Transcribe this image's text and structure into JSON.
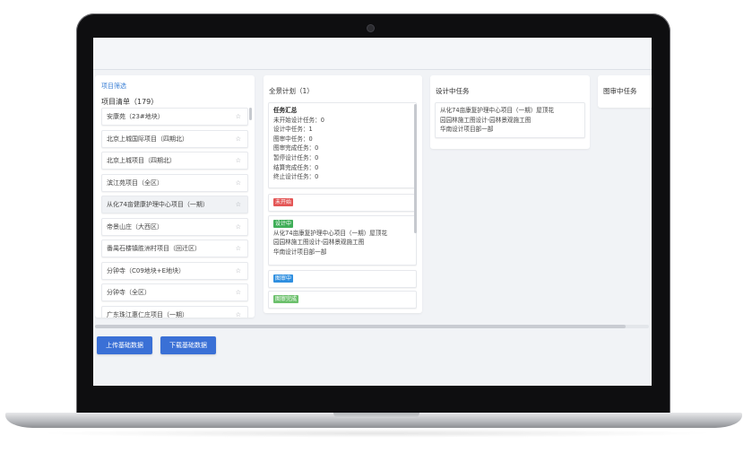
{
  "filter": {
    "title": "项目筛选",
    "list_label": "项目清单（179）"
  },
  "projects": [
    {
      "name": "安康苑（23#地块）",
      "active": false
    },
    {
      "name": "北京上城国际项目（四期北）",
      "active": false
    },
    {
      "name": "北京上城项目（四期北）",
      "active": false
    },
    {
      "name": "滨江苑项目（全区）",
      "active": false
    },
    {
      "name": "从化74亩健康护理中心项目（一期）",
      "active": true
    },
    {
      "name": "帝景山庄（大西区）",
      "active": false
    },
    {
      "name": "番禺石楼镇胜洲村项目（回迁区）",
      "active": false
    },
    {
      "name": "分钟寺（C09地块+E地块）",
      "active": false
    },
    {
      "name": "分钟寺（全区）",
      "active": false
    },
    {
      "name": "广东珠江惠仁庄项目（一期）",
      "active": false
    }
  ],
  "star_glyph": "☆",
  "columns": {
    "overview": {
      "title": "全景计划（1）",
      "summary": {
        "heading": "任务汇总",
        "lines": [
          "未开始设计任务：0",
          "设计中任务：1",
          "图审中任务：0",
          "图审完成任务：0",
          "暂停设计任务：0",
          "结算完成任务：0",
          "终止设计任务：0"
        ]
      },
      "statuses": [
        {
          "tag": "未开始",
          "color": "#e45656"
        },
        {
          "tag": "设计中",
          "color": "#3fae58",
          "lines": [
            "从化74亩康复护理中心项目（一期）屋顶花",
            "园园林施工图设计-园林景观施工图",
            "华南设计项目部一部"
          ]
        },
        {
          "tag": "图审中",
          "color": "#2f8fe0"
        },
        {
          "tag": "图审完成",
          "color": "#6cc06c"
        }
      ]
    },
    "designing": {
      "title": "设计中任务",
      "card_lines": [
        "从化74亩康复护理中心项目（一期）屋顶花",
        "园园林施工图设计-园林景观施工图",
        "华南设计项目部一部"
      ]
    },
    "reviewing": {
      "title": "图审中任务"
    }
  },
  "buttons": {
    "upload": "上传基础数据",
    "download": "下载基础数据"
  },
  "colors": {
    "accent": "#3a70d6",
    "filter_link": "#3a7fd5",
    "screen_bg": "#f1f3f6"
  }
}
